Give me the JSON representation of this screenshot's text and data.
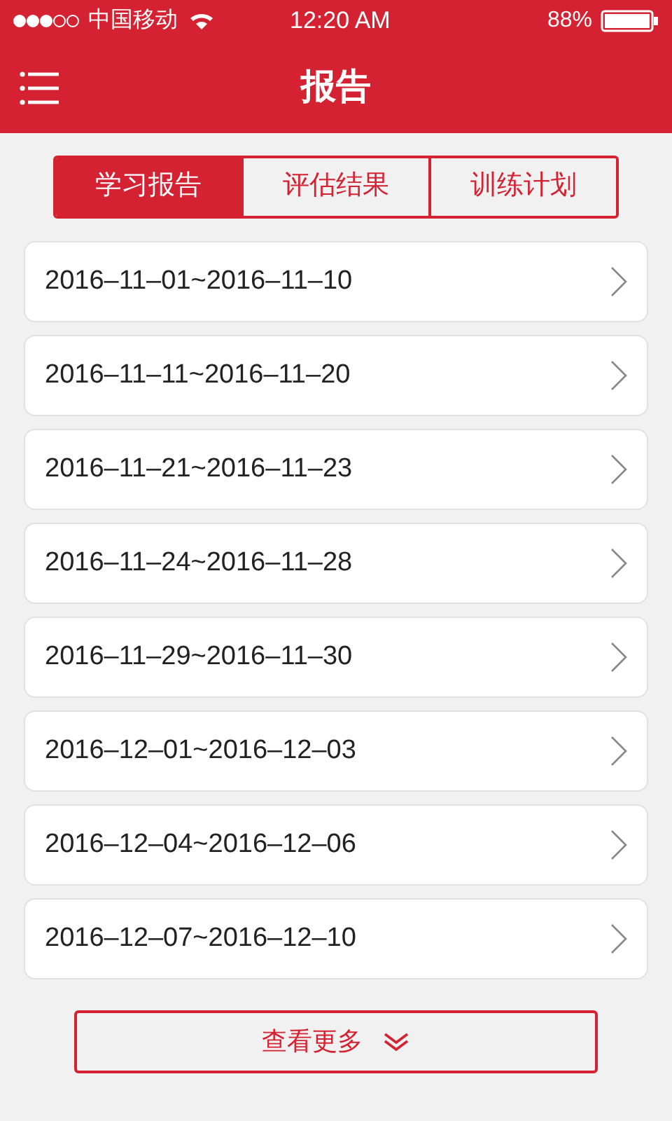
{
  "status_bar": {
    "carrier": "中国移动",
    "time": "12:20 AM",
    "battery": "88%"
  },
  "nav_bar": {
    "title": "报告"
  },
  "tabs": [
    {
      "label": "学习报告",
      "selected": true
    },
    {
      "label": "评估结果",
      "selected": false
    },
    {
      "label": "训练计划",
      "selected": false
    }
  ],
  "reports": [
    {
      "range": "2016–11–01~2016–11–10"
    },
    {
      "range": "2016–11–11~2016–11–20"
    },
    {
      "range": "2016–11–21~2016–11–23"
    },
    {
      "range": "2016–11–24~2016–11–28"
    },
    {
      "range": "2016–11–29~2016–11–30"
    },
    {
      "range": "2016–12–01~2016–12–03"
    },
    {
      "range": "2016–12–04~2016–12–06"
    },
    {
      "range": "2016–12–07~2016–12–10"
    }
  ],
  "more_button": {
    "label": "查看更多"
  }
}
